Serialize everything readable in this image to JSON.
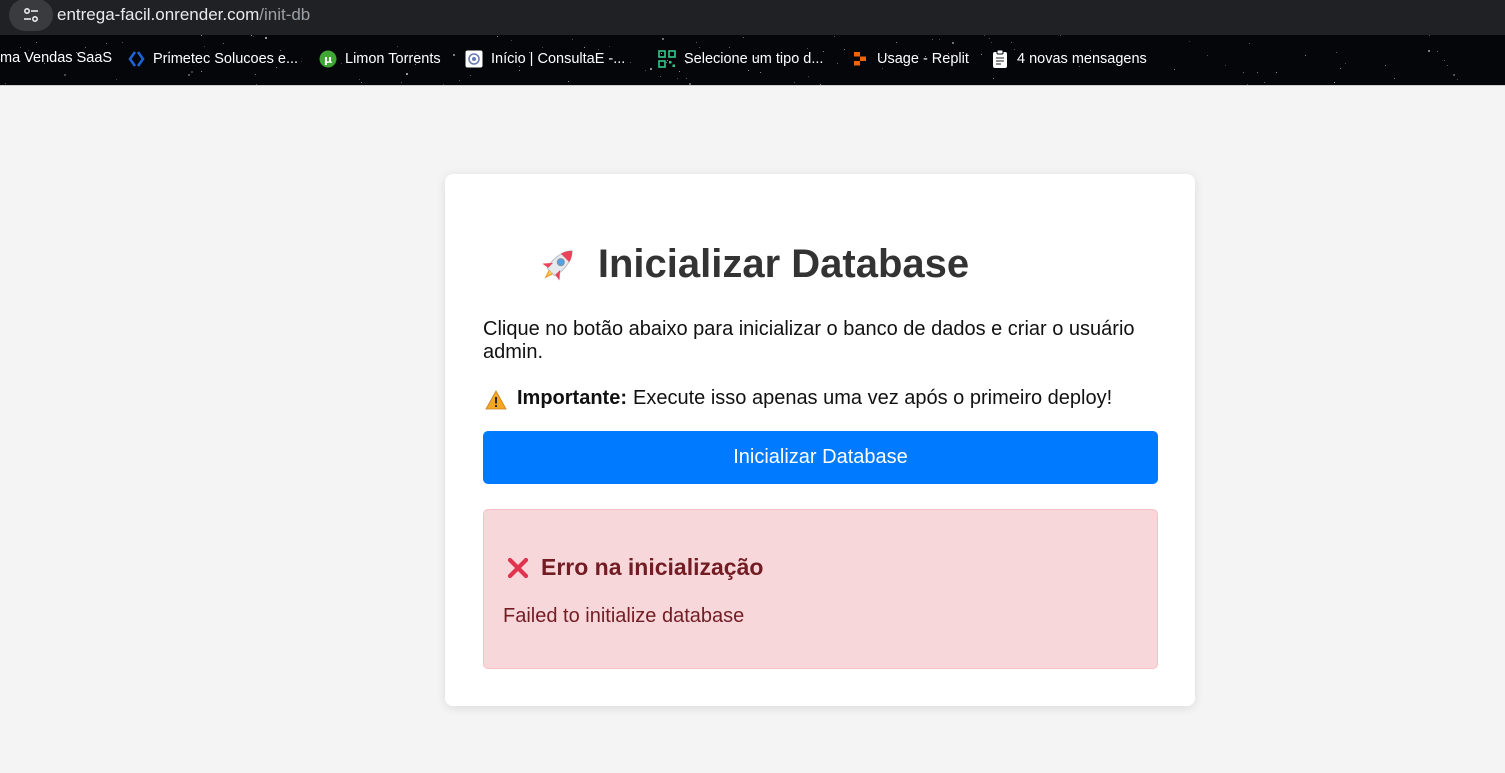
{
  "browser": {
    "url_host": "entrega-facil.onrender.com",
    "url_path": "/init-db"
  },
  "bookmarks": [
    {
      "label": "ma Vendas SaaS",
      "icon": "none"
    },
    {
      "label": "Primetec Solucoes e...",
      "icon": "primetec-icon"
    },
    {
      "label": "Limon Torrents",
      "icon": "utorrent-icon"
    },
    {
      "label": "Início | ConsultaE -...",
      "icon": "consultae-icon"
    },
    {
      "label": "Selecione um tipo d...",
      "icon": "qr-code-icon"
    },
    {
      "label": "Usage - Replit",
      "icon": "replit-icon"
    },
    {
      "label": "4 novas mensagens",
      "icon": "clipboard-icon"
    }
  ],
  "card": {
    "title": "Inicializar Database",
    "title_icon": "rocket-icon",
    "description": "Clique no botão abaixo para inicializar o banco de dados e criar o usuário admin.",
    "important_label": "Importante:",
    "important_text": "Execute isso apenas uma vez após o primeiro deploy!",
    "button_label": "Inicializar Database"
  },
  "error": {
    "title": "Erro na inicialização",
    "message": "Failed to initialize database",
    "icon": "cross-icon"
  },
  "colors": {
    "button": "#007bff",
    "error_bg": "#f8d7da",
    "error_text": "#721c24",
    "page_bg": "#f4f4f4"
  }
}
